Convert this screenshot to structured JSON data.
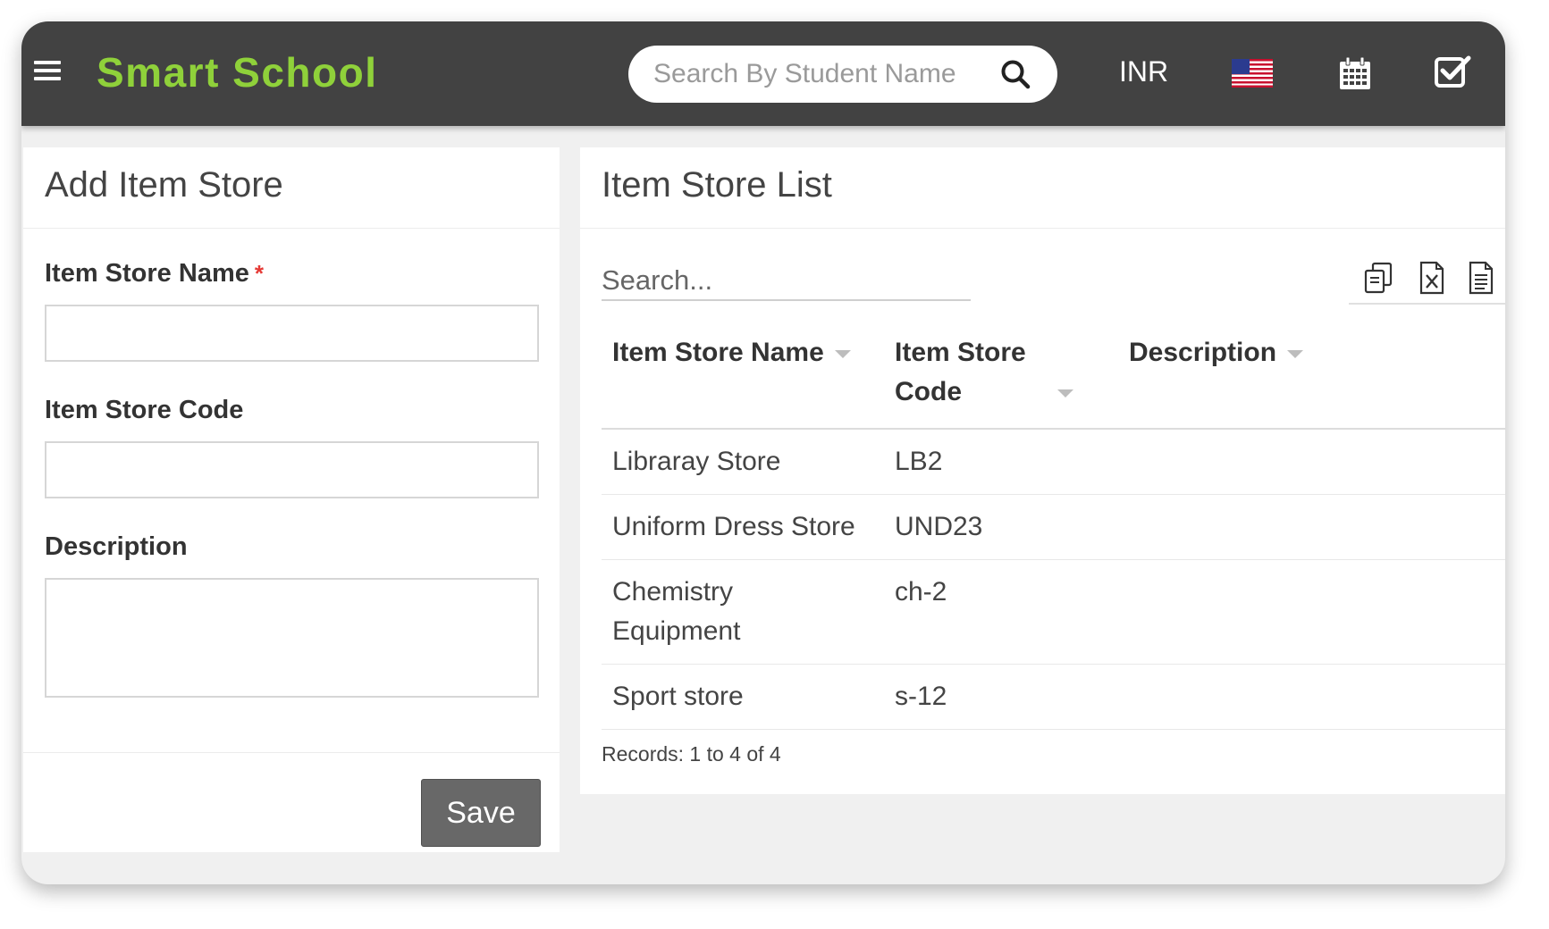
{
  "header": {
    "brand": "Smart School",
    "search": {
      "placeholder": "Search By Student Name"
    },
    "currency": "INR",
    "icons": [
      "menu-icon",
      "search-icon",
      "us-flag-icon",
      "calendar-icon",
      "checkbox-icon"
    ],
    "brand_color": "#8fd13a",
    "bar_color": "#424242"
  },
  "add_panel": {
    "title": "Add Item Store",
    "fields": {
      "name_label": "Item Store Name",
      "required_mark": "*",
      "name_value": "",
      "code_label": "Item Store Code",
      "code_value": "",
      "description_label": "Description",
      "description_value": ""
    },
    "save_label": "Save"
  },
  "list_panel": {
    "title": "Item Store List",
    "search_placeholder": "Search...",
    "tool_icons": [
      "copy-icon",
      "excel-icon",
      "document-icon"
    ],
    "columns": [
      "Item Store Name",
      "Item Store Code",
      "Description"
    ],
    "rows": [
      {
        "name": "Libraray Store",
        "code": "LB2",
        "description": ""
      },
      {
        "name": "Uniform Dress Store",
        "code": "UND23",
        "description": ""
      },
      {
        "name": "Chemistry Equipment",
        "code": "ch-2",
        "description": ""
      },
      {
        "name": "Sport store",
        "code": "s-12",
        "description": ""
      }
    ],
    "records": "Records: 1 to 4 of 4"
  }
}
